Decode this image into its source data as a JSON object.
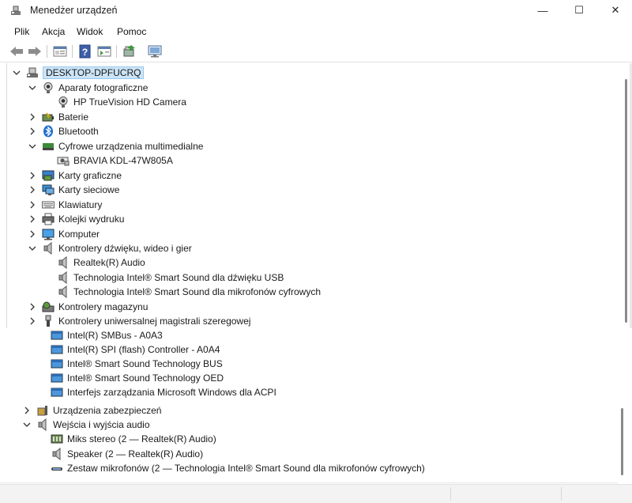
{
  "window": {
    "title": "Menedżer urządzeń",
    "min_glyph": "—",
    "max_glyph": "☐",
    "close_glyph": "✕"
  },
  "menu": [
    "Plik",
    "Akcja",
    "Widok",
    "Pomoc"
  ],
  "toolbar": [
    "back-icon",
    "forward-icon",
    "properties-icon",
    "help-icon",
    "show-hidden-icon",
    "update-driver-icon",
    "scan-hardware-icon"
  ],
  "tree": {
    "root": "DESKTOP-DPFUCRQ",
    "nodes": [
      {
        "label": "Aparaty fotograficzne",
        "icon": "camera-icon",
        "expanded": true,
        "children": [
          "HP TrueVision HD Camera"
        ]
      },
      {
        "label": "Baterie",
        "icon": "battery-icon",
        "expanded": false
      },
      {
        "label": "Bluetooth",
        "icon": "bluetooth-icon",
        "expanded": false
      },
      {
        "label": "Cyfrowe urządzenia multimedialne",
        "icon": "media-device-icon",
        "expanded": true,
        "children": [
          "BRAVIA KDL-47W805A"
        ]
      },
      {
        "label": "Karty graficzne",
        "icon": "display-adapter-icon",
        "expanded": false
      },
      {
        "label": "Karty sieciowe",
        "icon": "network-adapter-icon",
        "expanded": false
      },
      {
        "label": "Klawiatury",
        "icon": "keyboard-icon",
        "expanded": false
      },
      {
        "label": "Kolejki wydruku",
        "icon": "printer-icon",
        "expanded": false
      },
      {
        "label": "Komputer",
        "icon": "computer-icon",
        "expanded": false
      },
      {
        "label": "Kontrolery dźwięku, wideo i gier",
        "icon": "speaker-icon",
        "expanded": true,
        "children": [
          "Realtek(R) Audio",
          "Technologia Intel® Smart Sound dla dźwięku USB",
          "Technologia Intel® Smart Sound dla mikrofonów cyfrowych"
        ]
      },
      {
        "label": "Kontrolery magazynu",
        "icon": "storage-controller-icon",
        "expanded": false
      },
      {
        "label": "Kontrolery uniwersalnej magistrali szeregowej",
        "icon": "usb-icon",
        "expanded": false
      }
    ],
    "system_devices": [
      "Intel(R) SMBus - A0A3",
      "Intel(R) SPI (flash) Controller - A0A4",
      "Intel® Smart Sound Technology BUS",
      "Intel® Smart Sound Technology OED",
      "Interfejs zarządzania Microsoft Windows dla ACPI"
    ],
    "security": "Urządzenia zabezpieczeń",
    "audio_io": {
      "label": "Wejścia i wyjścia audio",
      "children": [
        {
          "label": "Miks stereo (2 — Realtek(R) Audio)",
          "icon": "stereo-mix-icon"
        },
        {
          "label": "Speaker (2 — Realtek(R) Audio)",
          "icon": "speaker-icon"
        },
        {
          "label": "Zestaw mikrofonów (2 — Technologia Intel® Smart Sound dla mikrofonów cyfrowych)",
          "icon": "microphone-array-icon"
        }
      ]
    }
  }
}
